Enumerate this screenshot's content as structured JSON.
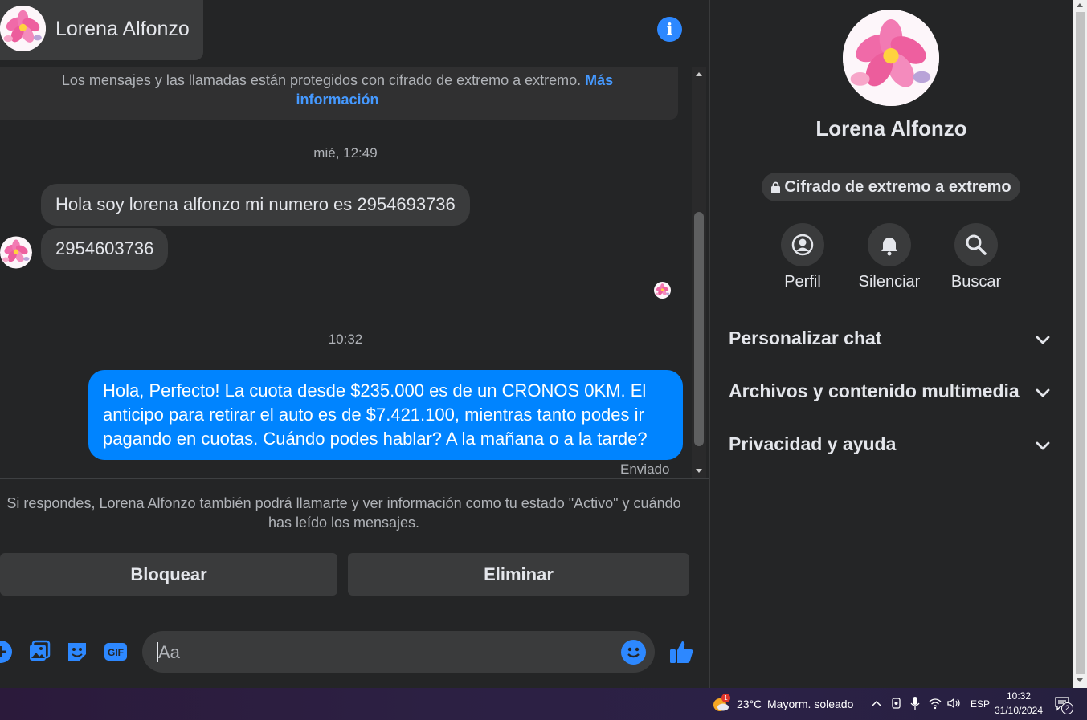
{
  "header": {
    "name": "Lorena Alfonzo"
  },
  "chat": {
    "encryption_notice": "Los mensajes y las llamadas están protegidos con cifrado de extremo a extremo.",
    "encryption_link": "Más información",
    "timestamp_1": "mié, 12:49",
    "incoming_1": "Hola soy lorena alfonzo mi numero es 2954693736",
    "incoming_2": "2954603736",
    "timestamp_2": "10:32",
    "outgoing_1": "Hola, Perfecto! La cuota desde $235.000 es de un CRONOS 0KM. El anticipo para retirar el auto es de $7.421.100, mientras tanto podes ir pagando en cuotas. Cuándo podes hablar? A la mañana o a la tarde?",
    "sent_status": "Enviado",
    "reply_notice": "Si respondes, Lorena Alfonzo también podrá llamarte y ver información como tu estado \"Activo\" y cuándo has leído los mensajes.",
    "block_label": "Bloquear",
    "delete_label": "Eliminar"
  },
  "composer": {
    "placeholder": "Aa",
    "gif_label": "GIF"
  },
  "panel": {
    "name": "Lorena Alfonzo",
    "encryption_pill": "Cifrado de extremo a extremo",
    "actions": [
      {
        "label": "Perfil",
        "icon": "profile-icon"
      },
      {
        "label": "Silenciar",
        "icon": "bell-icon"
      },
      {
        "label": "Buscar",
        "icon": "search-icon"
      }
    ],
    "sections": [
      {
        "label": "Personalizar chat"
      },
      {
        "label": "Archivos y contenido multimedia"
      },
      {
        "label": "Privacidad y ayuda"
      }
    ]
  },
  "taskbar": {
    "weather_badge": "1",
    "temperature": "23°C",
    "weather_text": "Mayorm. soleado",
    "language": "ESP",
    "time": "10:32",
    "date": "31/10/2024",
    "notifications": "2"
  },
  "colors": {
    "accent": "#0084ff",
    "icon_blue": "#2d88ff",
    "background": "#242526",
    "bubble_in": "#3a3b3c"
  }
}
